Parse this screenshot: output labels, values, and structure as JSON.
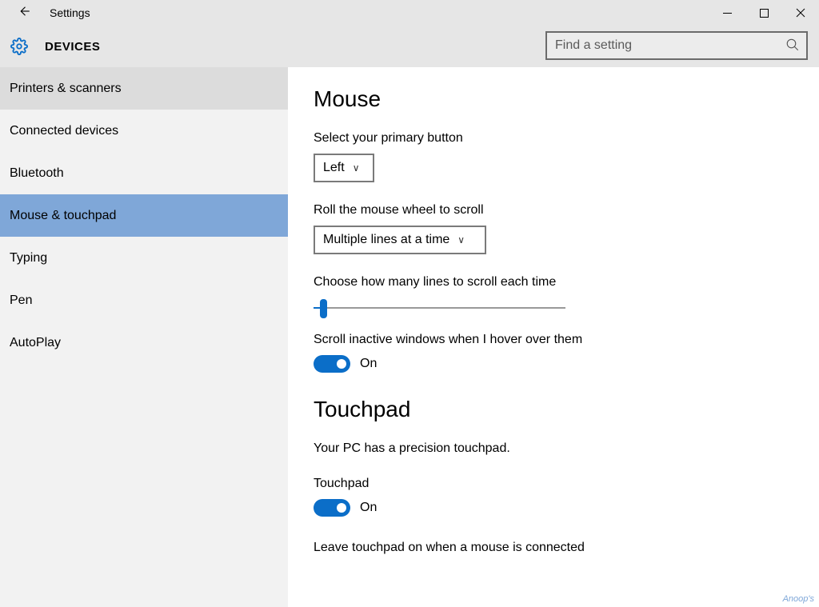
{
  "window": {
    "title": "Settings",
    "category": "DEVICES"
  },
  "search": {
    "placeholder": "Find a setting",
    "value": ""
  },
  "sidebar": {
    "items": [
      {
        "label": "Printers & scanners",
        "state": "hover"
      },
      {
        "label": "Connected devices",
        "state": ""
      },
      {
        "label": "Bluetooth",
        "state": ""
      },
      {
        "label": "Mouse & touchpad",
        "state": "selected"
      },
      {
        "label": "Typing",
        "state": ""
      },
      {
        "label": "Pen",
        "state": ""
      },
      {
        "label": "AutoPlay",
        "state": ""
      }
    ]
  },
  "main": {
    "mouse": {
      "heading": "Mouse",
      "primary_label": "Select your primary button",
      "primary_value": "Left",
      "scroll_mode_label": "Roll the mouse wheel to scroll",
      "scroll_mode_value": "Multiple lines at a time",
      "lines_label": "Choose how many lines to scroll each time",
      "inactive_label": "Scroll inactive windows when I hover over them",
      "inactive_state": "On"
    },
    "touchpad": {
      "heading": "Touchpad",
      "precision_text": "Your PC has a precision touchpad.",
      "toggle_label": "Touchpad",
      "toggle_state": "On",
      "leave_on_label": "Leave touchpad on when a mouse is connected"
    }
  },
  "watermark": "Anoop's"
}
